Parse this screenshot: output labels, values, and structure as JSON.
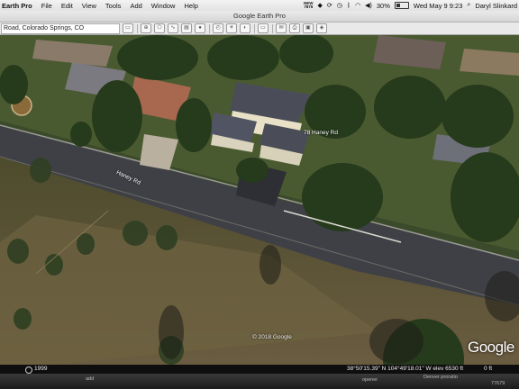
{
  "menubar": {
    "app_name": "Earth Pro",
    "menus": [
      "File",
      "Edit",
      "View",
      "Tools",
      "Add",
      "Window",
      "Help"
    ],
    "new_badge_top": "NEW",
    "new_badge_bottom": "7875",
    "battery_percent": "30%",
    "datetime": "Wed May 9  9:23",
    "user": "Daryl Slinkard"
  },
  "window": {
    "title": "Google Earth Pro"
  },
  "toolbar": {
    "search_value": "Road, Colorado Springs, CO"
  },
  "map": {
    "street_label_road": "Haney Rd",
    "street_label_house": "78 Haney Rd",
    "copyright": "© 2018 Google",
    "logo": "Google"
  },
  "statusbar": {
    "year": "1999",
    "coordinates": "38°50'15.39\" N  104°49'18.01\" W  elev  6530 ft",
    "eye_alt": "0 ft"
  },
  "dock": {
    "item_1": "add",
    "item_2": "opener",
    "item_3": "Denver proratio",
    "item_4": "77679"
  },
  "colors": {
    "road": "#3f4046",
    "grass": "#5f5a35",
    "trees": "#263a1c",
    "roof": "#4a4d57"
  }
}
